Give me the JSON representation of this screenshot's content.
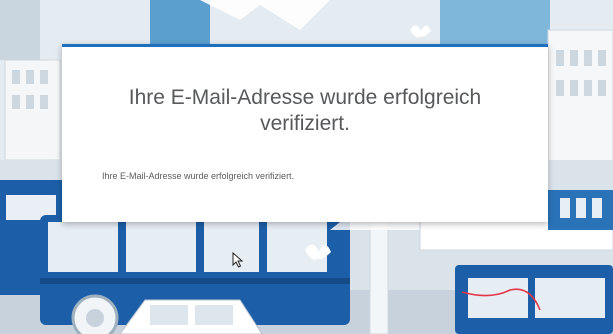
{
  "colors": {
    "accent": "#1f6fbf",
    "bus_blue": "#1c5fa8",
    "sky": "#dfe7ee"
  },
  "dialog": {
    "title": "Ihre E-Mail-Adresse wurde erfolgreich verifiziert.",
    "message": "Ihre E-Mail-Adresse wurde erfolgreich verifiziert."
  },
  "background": {
    "description_icon": "city-street-illustration-icon"
  },
  "cursor_icon": "mouse-pointer-icon"
}
